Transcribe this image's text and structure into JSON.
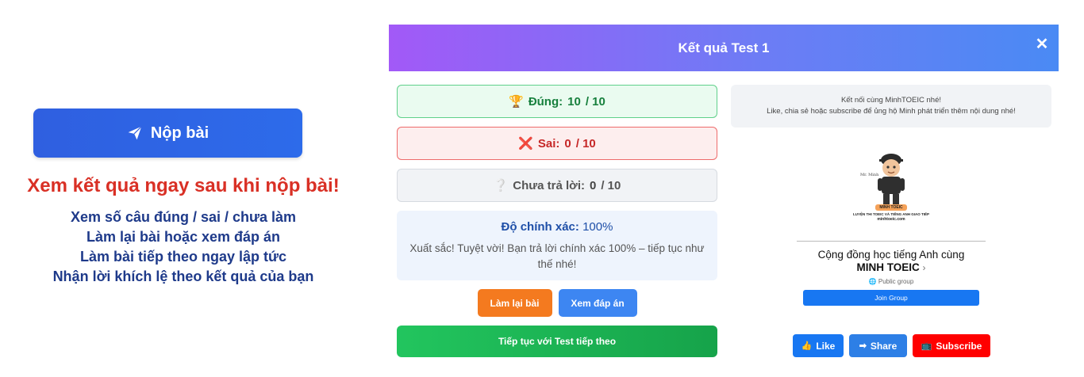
{
  "promo": {
    "submit_label": "Nộp bài",
    "title": "Xem kết quả ngay sau khi nộp bài!",
    "bullets": [
      "Xem số câu đúng / sai / chưa làm",
      "Làm lại bài hoặc xem đáp án",
      "Làm bài tiếp theo ngay lập tức",
      "Nhận lời khích lệ theo kết quả của bạn"
    ]
  },
  "modal": {
    "title": "Kết quả Test 1",
    "close": "✕",
    "stats": {
      "correct": {
        "icon": "trophy-icon",
        "label": "Đúng:",
        "value": "10",
        "total": "/ 10"
      },
      "wrong": {
        "icon": "cross-icon",
        "label": "Sai:",
        "value": "0",
        "total": "/ 10"
      },
      "unanswered": {
        "icon": "question-icon",
        "label": "Chưa trả lời:",
        "value": "0",
        "total": "/ 10"
      }
    },
    "accuracy": {
      "label": "Độ chính xác:",
      "value": "100%",
      "message": "Xuất sắc! Tuyệt vời! Bạn trả lời chính xác 100% – tiếp tục như thế nhé!"
    },
    "buttons": {
      "retry": "Làm lại bài",
      "answers": "Xem đáp án",
      "next": "Tiếp tục với Test tiếp theo"
    },
    "connect": {
      "line1": "Kết nối cùng MinhTOEIC nhé!",
      "line2": "Like, chia sẻ hoặc subscribe để ủng hộ Minh phát triển thêm nội dung nhé!"
    },
    "facebook": {
      "mascot_name": "Mr. Minh",
      "brand": "MINH TOEIC",
      "tagline": "LUYỆN THI TOEIC VÀ TIẾNG ANH GIAO TIẾP",
      "site": "minhtoeic.com",
      "group_name_line1": "Cộng đồng học tiếng Anh cùng",
      "group_name_line2": "MINH TOEIC",
      "privacy": "Public group",
      "join": "Join Group"
    },
    "social": {
      "like": "Like",
      "share": "Share",
      "subscribe": "Subscribe"
    }
  },
  "colors": {
    "header_gradient_start": "#a259f7",
    "header_gradient_end": "#4a8af4",
    "correct": "#17803d",
    "wrong": "#c62828",
    "promo_title": "#d93025",
    "promo_list": "#1e3a8a"
  }
}
